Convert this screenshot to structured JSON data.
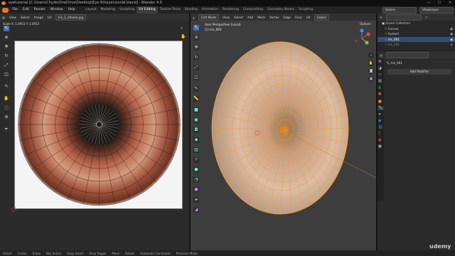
{
  "window": {
    "title": "eyetutorial [C:\\Users\\Chyde\\OneDrive\\Desktop\\Eye Kit\\eyetutorial.blend] - Blender 4.0",
    "minimize": "—",
    "maximize": "☐",
    "close": "✕"
  },
  "menubar": {
    "menus": [
      "File",
      "Edit",
      "Render",
      "Window",
      "Help"
    ],
    "workspaces": [
      "Layout",
      "Modeling",
      "Sculpting",
      "UV Editing",
      "Texture Paint",
      "Shading",
      "Animation",
      "Rendering",
      "Compositing",
      "Geometry Nodes",
      "Scripting"
    ],
    "active_workspace": "UV Editing",
    "scene_label": "Scene",
    "viewlayer_label": "ViewLayer"
  },
  "uv_editor": {
    "header_items": [
      "View",
      "Select",
      "Image",
      "UV"
    ],
    "image_name": "Iris_1_Albedo.jpg",
    "scale_readout": "Scale X: 1.0953  Y: 1.0953",
    "tools": [
      "cursor-select",
      "cursor",
      "move",
      "rotate",
      "scale",
      "transform",
      "annotate",
      "grab",
      "relax",
      "pinch",
      "sample"
    ]
  },
  "viewport": {
    "mode": "Edit Mode",
    "header_items": [
      "View",
      "Select",
      "Add",
      "Mesh",
      "Vertex",
      "Edge",
      "Face",
      "UV"
    ],
    "orientation": "Global",
    "perspective_label": "User Perspective (Local)",
    "object_label": "(1) Iris_001",
    "options_label": "Options"
  },
  "outliner": {
    "root": "Scene Collection",
    "items": [
      {
        "label": "Cornea",
        "selected": false
      },
      {
        "label": "Eyeball",
        "selected": false
      },
      {
        "label": "Iris_001",
        "selected": true
      },
      {
        "label": "Iris_002",
        "selected": false
      }
    ]
  },
  "properties": {
    "object_name": "Iris_001",
    "add_modifier_label": "Add Modifier"
  },
  "statusbar": {
    "items": [
      "Select",
      "Center",
      "B box",
      "Box Select",
      "Snap Invert",
      "Snap Toggle",
      "Move",
      "Rotate",
      "Automatic Constraint",
      "Precision Mode"
    ]
  },
  "watermark": "udemy",
  "colors": {
    "active_tab": "#3d3d3d",
    "selection_blue": "#334d80",
    "tool_active": "#4772b3",
    "mesh_orange": "#ff9a1c",
    "iris_red": "#b8644a"
  }
}
